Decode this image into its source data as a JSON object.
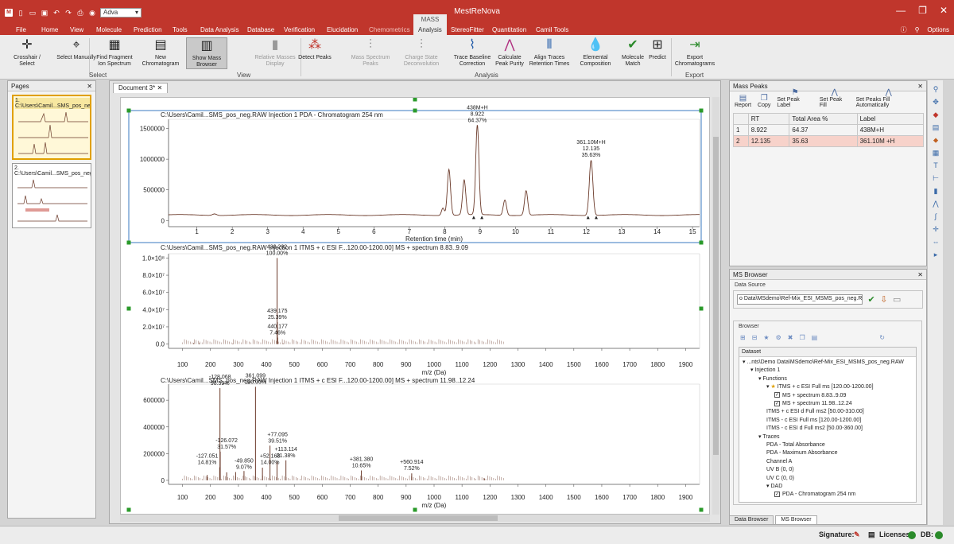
{
  "window": {
    "app_title": "MestReNova",
    "context_tab": "MASS",
    "quick_selector": "Adva",
    "controls": [
      "—",
      "❐",
      "✕"
    ]
  },
  "menu": {
    "file": "File",
    "tabs": [
      "Home",
      "View",
      "Molecule",
      "Prediction",
      "Tools",
      "Data Analysis",
      "Database",
      "Verification",
      "Elucidation",
      "Chemometrics",
      "Analysis",
      "StereoFitter",
      "Quantitation",
      "Camil Tools"
    ],
    "active_tab": "Analysis",
    "options": "Options"
  },
  "ribbon": {
    "buttons": [
      {
        "label": "Crosshair / Select",
        "icon": "crosshair-icon",
        "glyph": "✛"
      },
      {
        "label": "Select Manually",
        "icon": "select-manually-icon",
        "glyph": "⌖"
      },
      {
        "label": "Find Fragment Ion Spectrum",
        "icon": "find-fragment-icon",
        "glyph": "▦"
      },
      {
        "label": "New Chromatogram",
        "icon": "new-chromatogram-icon",
        "glyph": "▤"
      },
      {
        "label": "Show Mass Browser",
        "icon": "mass-browser-icon",
        "glyph": "▥"
      },
      {
        "label": "Relative Masses Display",
        "icon": "relative-masses-icon",
        "glyph": "▮"
      },
      {
        "label": "Detect Peaks",
        "icon": "detect-peaks-icon",
        "glyph": "⁂"
      },
      {
        "label": "Mass Spectrum Peaks",
        "icon": "mass-spectrum-peaks-icon",
        "glyph": "⫶"
      },
      {
        "label": "Charge State Deconvolution",
        "icon": "deconvolution-icon",
        "glyph": "⫶"
      },
      {
        "label": "Trace Baseline Correction",
        "icon": "baseline-icon",
        "glyph": "⌇"
      },
      {
        "label": "Calculate Peak Purity",
        "icon": "peak-purity-icon",
        "glyph": "⋀"
      },
      {
        "label": "Align Traces Retention Times",
        "icon": "align-traces-icon",
        "glyph": "⫴"
      },
      {
        "label": "Elemental Composition",
        "icon": "elemental-composition-icon",
        "glyph": "💧"
      },
      {
        "label": "Molecule Match",
        "icon": "molecule-match-icon",
        "glyph": "✔"
      },
      {
        "label": "Predict",
        "icon": "predict-icon",
        "glyph": "⊞"
      },
      {
        "label": "Export Chromatograms",
        "icon": "export-icon",
        "glyph": "⇥"
      }
    ],
    "groups": [
      "Select",
      "View",
      "Analysis",
      "Export"
    ]
  },
  "pages_panel": {
    "title": "Pages",
    "pages": [
      {
        "label": "1. C:\\Users\\Camil...SMS_pos_neg"
      },
      {
        "label": "2. C:\\Users\\Camil...SMS_pos_neg"
      }
    ]
  },
  "document": {
    "tab": "Document 3*"
  },
  "chart_data": [
    {
      "type": "line",
      "title": "C:\\Users\\Camil...SMS_pos_neg.RAW Injection 1  PDA - Chromatogram 254 nm",
      "xlabel": "Retention time (min)",
      "ylabel": "",
      "xlim": [
        0.2,
        15.2
      ],
      "ylim": [
        -100000,
        1650000
      ],
      "x_ticks": [
        1,
        2,
        3,
        4,
        5,
        6,
        7,
        8,
        9,
        10,
        11,
        12,
        13,
        14,
        15
      ],
      "y_ticks": [
        0,
        500000,
        1000000,
        1500000
      ],
      "y_tick_labels": [
        "0",
        "500000",
        "1000000",
        "1500000"
      ],
      "peaks": [
        {
          "x": 1.5,
          "y": 25000,
          "w": 0.06
        },
        {
          "x": 7.95,
          "y": 120000,
          "w": 0.04
        },
        {
          "x": 8.12,
          "y": 750000,
          "w": 0.045
        },
        {
          "x": 8.55,
          "y": 570000,
          "w": 0.045
        },
        {
          "x": 8.922,
          "y": 1460000,
          "w": 0.045
        },
        {
          "x": 9.7,
          "y": 250000,
          "w": 0.045
        },
        {
          "x": 10.3,
          "y": 400000,
          "w": 0.045
        },
        {
          "x": 12.135,
          "y": 900000,
          "w": 0.05
        }
      ],
      "baseline": 90000,
      "annotations": [
        {
          "x": 8.922,
          "y": 1460000,
          "lines": [
            "438M+H",
            "8.922",
            "64.37%"
          ]
        },
        {
          "x": 12.135,
          "y": 900000,
          "lines": [
            "361.10M+H",
            "12.135",
            "35.63%"
          ]
        }
      ]
    },
    {
      "type": "bar",
      "title": "C:\\Users\\Camil...SMS_pos_neg.RAW Injection 1 ITMS + c ESI F...120.00-1200.00] MS + spectrum 8.83..9.09",
      "xlabel": "m/z (Da)",
      "ylabel": "",
      "xlim": [
        50,
        1950
      ],
      "ylim": [
        -5000000,
        105000000
      ],
      "x_ticks": [
        100,
        200,
        300,
        400,
        500,
        600,
        700,
        800,
        900,
        1000,
        1100,
        1200,
        1300,
        1400,
        1500,
        1600,
        1700,
        1800,
        1900
      ],
      "y_ticks": [
        0,
        20000000,
        40000000,
        60000000,
        80000000,
        100000000
      ],
      "y_tick_labels": [
        "0.0",
        "2.0×10⁷",
        "4.0×10⁷",
        "6.0×10⁷",
        "8.0×10⁷",
        "1.0×10⁸"
      ],
      "sticks": [
        {
          "x": 140,
          "y": 1200000
        },
        {
          "x": 160,
          "y": 900000
        },
        {
          "x": 280,
          "y": 700000
        },
        {
          "x": 438.202,
          "y": 100000000
        },
        {
          "x": 439.175,
          "y": 25390000
        },
        {
          "x": 440.177,
          "y": 7460000
        },
        {
          "x": 460,
          "y": 900000
        }
      ],
      "annotations": [
        {
          "x": 438.202,
          "y": 100000000,
          "lines": [
            "438.202",
            "100.00%"
          ]
        },
        {
          "x": 439.175,
          "y": 25390000,
          "lines": [
            "439.175",
            "25.39%"
          ]
        },
        {
          "x": 440.177,
          "y": 7460000,
          "lines": [
            "440.177",
            "7.46%"
          ]
        }
      ]
    },
    {
      "type": "bar",
      "title": "C:\\Users\\Camil...SMS_pos_neg.RAW Injection 1 ITMS + c ESI F...120.00-1200.00] MS + spectrum 11.98..12.24",
      "xlabel": "m/z (Da)",
      "ylabel": "",
      "xlim": [
        50,
        1950
      ],
      "ylim": [
        -30000,
        720000
      ],
      "x_ticks": [
        100,
        200,
        300,
        400,
        500,
        600,
        700,
        800,
        900,
        1000,
        1100,
        1200,
        1300,
        1400,
        1500,
        1600,
        1700,
        1800,
        1900
      ],
      "y_ticks": [
        0,
        200000,
        400000,
        600000
      ],
      "y_tick_labels": [
        "0",
        "200000",
        "400000",
        "600000"
      ],
      "sticks": [
        {
          "x": 188,
          "y": 40000
        },
        {
          "x": 233,
          "y": 98000
        },
        {
          "x": 234,
          "y": 690000
        },
        {
          "x": 235,
          "y": 215000
        },
        {
          "x": 258,
          "y": 60000
        },
        {
          "x": 290,
          "y": 62000
        },
        {
          "x": 320,
          "y": 70000
        },
        {
          "x": 361.099,
          "y": 700000
        },
        {
          "x": 386,
          "y": 95000
        },
        {
          "x": 413,
          "y": 260000
        },
        {
          "x": 438,
          "y": 140000
        },
        {
          "x": 470,
          "y": 150000
        },
        {
          "x": 740,
          "y": 74000
        },
        {
          "x": 920,
          "y": 52000
        },
        {
          "x": 1180,
          "y": 15000
        }
      ],
      "annotations": [
        {
          "x": 234,
          "y": 690000,
          "lines": [
            "-128.068",
            "98.59%"
          ]
        },
        {
          "x": 361.099,
          "y": 700000,
          "lines": [
            "361.099",
            "100.00%"
          ]
        },
        {
          "x": 258,
          "y": 215000,
          "lines": [
            "-126.072",
            "31.57%"
          ]
        },
        {
          "x": 188,
          "y": 98000,
          "lines": [
            "-127.051",
            "14.81%"
          ]
        },
        {
          "x": 440,
          "y": 260000,
          "lines": [
            "+77.095",
            "39.51%"
          ]
        },
        {
          "x": 470,
          "y": 150000,
          "lines": [
            "+113.114",
            "21.38%"
          ]
        },
        {
          "x": 413,
          "y": 98000,
          "lines": [
            "+52.168",
            "14.00%"
          ]
        },
        {
          "x": 320,
          "y": 62000,
          "lines": [
            "-49.850",
            "9.07%"
          ]
        },
        {
          "x": 740,
          "y": 74000,
          "lines": [
            "+381.380",
            "10.65%"
          ]
        },
        {
          "x": 920,
          "y": 52000,
          "lines": [
            "+560.914",
            "7.52%"
          ]
        }
      ]
    }
  ],
  "mass_peaks": {
    "title": "Mass Peaks",
    "toolbar": [
      "Report",
      "Copy",
      "Set Peak Label",
      "Set Peak Fill",
      "Set Peaks Fill Automatically"
    ],
    "columns": [
      "",
      "RT",
      "Total Area %",
      "Label"
    ],
    "rows": [
      {
        "n": "1",
        "rt": "8.922",
        "area": "64.37",
        "label": "438M+H"
      },
      {
        "n": "2",
        "rt": "12.135",
        "area": "35.63",
        "label": "361.10M +H"
      }
    ]
  },
  "ms_browser": {
    "title": "MS Browser",
    "data_source_label": "Data Source",
    "data_source_value": "o Data\\MSdemo\\Ref-Mix_ESI_MSMS_pos_neg.RAW",
    "browser_label": "Browser",
    "dataset_header": "Dataset",
    "tree": [
      {
        "text": "...nts\\Demo Data\\MSdemo\\Ref-Mix_ESI_MSMS_pos_neg.RAW",
        "level": 0,
        "toggle": "▾"
      },
      {
        "text": "Injection 1",
        "level": 1,
        "toggle": "▾"
      },
      {
        "text": "Functions",
        "level": 2,
        "toggle": "▾"
      },
      {
        "text": "ITMS + c ESI Full ms [120.00-1200.00]",
        "level": 3,
        "toggle": "▾",
        "star": true
      },
      {
        "text": "MS + spectrum 8.83..9.09",
        "level": 4,
        "checkbox": true
      },
      {
        "text": "MS + spectrum 11.98..12.24",
        "level": 4,
        "checkbox": true
      },
      {
        "text": "ITMS + c ESI d Full ms2 [50.00-310.00]",
        "level": 3
      },
      {
        "text": "ITMS - c ESI Full ms [120.00-1200.00]",
        "level": 3
      },
      {
        "text": "ITMS - c ESI d Full ms2 [50.00-360.00]",
        "level": 3
      },
      {
        "text": "Traces",
        "level": 2,
        "toggle": "▾"
      },
      {
        "text": "PDA - Total Absorbance",
        "level": 3
      },
      {
        "text": "PDA - Maximum Absorbance",
        "level": 3
      },
      {
        "text": "Channel A",
        "level": 3
      },
      {
        "text": "UV B (0, 0)",
        "level": 3
      },
      {
        "text": "UV C (0, 0)",
        "level": 3
      },
      {
        "text": "DAD",
        "level": 3,
        "toggle": "▾"
      },
      {
        "text": "PDA - Chromatogram 254 nm",
        "level": 4,
        "checkbox": true
      }
    ],
    "bottom_tabs": [
      "Data Browser",
      "MS Browser"
    ]
  },
  "status": {
    "signature": "Signature:",
    "licenses": "Licenses:",
    "db": "DB:"
  },
  "colors": {
    "titlebar": "#c0362c",
    "trace": "#6b3a2a",
    "selection_box": "#3a78c2",
    "handle": "#2a9a2a",
    "row_highlight": "#f7d2ca"
  }
}
